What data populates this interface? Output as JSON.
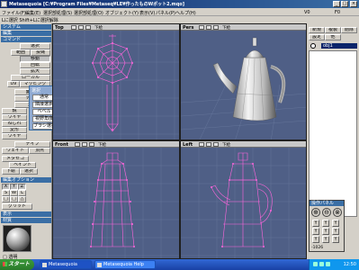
{
  "window": {
    "title": "Metasequoia [C:¥Program Files¥Metaseq¥LE¥作ったものWポット2.mqo]",
    "min_label": "_",
    "max_label": "□",
    "close_label": "×"
  },
  "menubar": {
    "items": [
      "ファイル(F)",
      "編集(E)",
      "選択部処理(S)",
      "選択部処理(O)",
      "オブジェクト(Y)",
      "表示(V)",
      "パネル(P)",
      "ヘルプ(H)"
    ],
    "v_label": "V0",
    "f_label": "F0"
  },
  "toolbar": {
    "hint": "Lに選択 Shift+Lに選択解除"
  },
  "left_panel": {
    "system_header": "システム",
    "edit_header": "編集",
    "command_header": "コマンド",
    "buttons": {
      "select": "選択",
      "range": "範囲",
      "rope": "投縄",
      "move": "移動",
      "rotate": "回転",
      "scale": "拡大",
      "local": "ローカル",
      "uv": "UV",
      "mapping": "マッピング",
      "vertex": "面生成",
      "knife": "ナイフ",
      "bend": "ねじれ",
      "face_gen": "変形",
      "mirror": "鏡",
      "wire": "ワイヤ",
      "knife2": "ナイフ",
      "weight": "ウェイト",
      "vertex_obj": "頂点",
      "metasequoia": "メタセコ",
      "paint": "ペイント",
      "dl": "下絵",
      "deselect": "選択"
    },
    "edit_option_header": "編集オプション",
    "option_buttons": [
      "X",
      "Y",
      "Z",
      "S",
      "W",
      "L",
      "□",
      "□",
      "△"
    ],
    "grid_snap": "グリッド",
    "display_header": "表示",
    "material_header": "材質",
    "material_check": "□ 透明"
  },
  "popup": {
    "title": "選択",
    "items": [
      "通常",
      "隣接選択",
      "ベベル",
      "視野角度",
      "ブラシ選択"
    ]
  },
  "viewports": {
    "top": {
      "label": "Top",
      "controls": [
        "□",
        "□",
        "□"
      ],
      "mode": "下絵"
    },
    "persp": {
      "label": "Pers",
      "controls": [
        "□",
        "□",
        "□"
      ],
      "mode": "下絵"
    },
    "front": {
      "label": "Front",
      "controls": [
        "□",
        "□",
        "□"
      ],
      "mode": "下絵"
    },
    "left": {
      "label": "Left",
      "controls": [
        "□",
        "□",
        "□"
      ],
      "mode": "下絵"
    }
  },
  "right_panel": {
    "tabs": [
      "新規",
      "複製",
      "削除",
      "設定",
      "他"
    ],
    "object_name": "obj1",
    "vis_icon": "eye-icon"
  },
  "navigator": {
    "title": "操作パネル",
    "buttons": [
      "⊕",
      "⊖",
      "⊗"
    ],
    "grid": [
      "Y",
      "Y",
      "Y",
      "Y",
      "Y",
      "Y",
      "Y",
      "Y",
      "Y"
    ],
    "coord": "-1026"
  },
  "taskbar": {
    "start_label": "スタート",
    "items": [
      "Metasequoia",
      "Metasequoia Help"
    ],
    "clock": "12:50"
  },
  "colors": {
    "viewport_bg": "#4f5f86",
    "wire_pink": "#ff66dd",
    "grid_line": "#6a7a9e",
    "title_blue": "#0a246a",
    "taskbar_blue": "#1941a5",
    "start_green": "#2a7a2a"
  }
}
